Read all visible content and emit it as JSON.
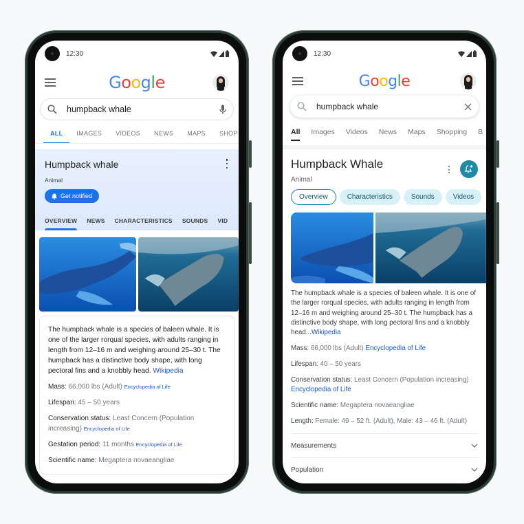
{
  "colors": {
    "page_background": "#f7f8fa",
    "google_blue": "#4285f4",
    "google_red": "#ea4335",
    "google_yellow": "#fbbc05",
    "google_green": "#34a853",
    "accent_blue": "#1a73e8",
    "teal_accent": "#1e8aa6"
  },
  "left_phone": {
    "status": {
      "time": "12:30",
      "icons": [
        "wifi-icon",
        "signal-icon",
        "battery-icon"
      ]
    },
    "header": {
      "logo": [
        "G",
        "o",
        "o",
        "g",
        "l",
        "e"
      ],
      "menu_icon": "menu-icon",
      "avatar": "avatar"
    },
    "search": {
      "value": "humpback whale",
      "left_icon": "search-icon",
      "right_icon": "mic-icon"
    },
    "tabs": [
      {
        "label": "ALL",
        "active": true
      },
      {
        "label": "IMAGES"
      },
      {
        "label": "VIDEOS"
      },
      {
        "label": "NEWS"
      },
      {
        "label": "MAPS"
      },
      {
        "label": "SHOP"
      }
    ],
    "knowledge_panel": {
      "title": "Humpback whale",
      "subtitle": "Animal",
      "notify_label": "Get notified",
      "tabs": [
        {
          "label": "OVERVIEW",
          "active": true
        },
        {
          "label": "NEWS"
        },
        {
          "label": "CHARACTERISTICS"
        },
        {
          "label": "SOUNDS"
        },
        {
          "label": "VID"
        }
      ]
    },
    "description": {
      "text": "The humpback whale is a species of baleen whale. It is one of the larger rorqual species, with adults ranging in length from 12–16 m and weighing around 25–30 t. The humpback has a distinctive body shape, with long pectoral fins and a knobbly head.",
      "source": "Wikipedia"
    },
    "facts": [
      {
        "label": "Mass:",
        "value": "66,000 lbs (Adult)",
        "source": "Encyclopedia of Life"
      },
      {
        "label": "Lifespan:",
        "value": "45 – 50 years",
        "source": ""
      },
      {
        "label": "Conservation status:",
        "value": "Least Concern (Population increasing)",
        "source": "Encyclopedia of Life"
      },
      {
        "label": "Gestation period:",
        "value": "11 months",
        "source": "Encyclopedia of Life"
      },
      {
        "label": "Scientific name:",
        "value": "Megaptera novaeangliae",
        "source": ""
      }
    ]
  },
  "right_phone": {
    "status": {
      "time": "12:30",
      "icons": [
        "wifi-icon",
        "signal-icon",
        "battery-icon"
      ]
    },
    "header": {
      "logo": [
        "G",
        "o",
        "o",
        "g",
        "l",
        "e"
      ],
      "menu_icon": "menu-icon",
      "avatar": "avatar"
    },
    "search": {
      "value": "humpback whale",
      "left_icon": "search-icon",
      "right_icon": "clear-icon"
    },
    "tabs": [
      {
        "label": "All",
        "active": true
      },
      {
        "label": "Images"
      },
      {
        "label": "Videos"
      },
      {
        "label": "News"
      },
      {
        "label": "Maps"
      },
      {
        "label": "Shopping"
      },
      {
        "label": "B"
      }
    ],
    "knowledge_panel": {
      "title": "Humpback Whale",
      "subtitle": "Animal",
      "notify_icon": "bell-plus-icon",
      "chips": [
        {
          "label": "Overview",
          "active": true
        },
        {
          "label": "Characteristics"
        },
        {
          "label": "Sounds"
        },
        {
          "label": "Videos"
        }
      ]
    },
    "description": {
      "text": "The humpback whale is a species of baleen whale. It is one of the larger rorqual species, with adults ranging in length from 12–16 m and weighing around 25–30 t. The humpback has a distinctive body shape, with long pectoral fins and a knobbly head...",
      "source": "Wikipedia"
    },
    "facts": [
      {
        "label": "Mass:",
        "value": "66,000 lbs (Adult)",
        "source": "Encyclopedia of Life"
      },
      {
        "label": "Lifespan:",
        "value": "40 – 50 years",
        "source": ""
      },
      {
        "label": "Conservation status:",
        "value": "Least Concern (Population increasing)",
        "source": "Encyclopedia of Life"
      },
      {
        "label": "Scientific name:",
        "value": "Megaptera novaeangliae",
        "source": ""
      },
      {
        "label": "Length:",
        "value": "Female: 49 – 52 ft. (Adult), Male: 43 – 46 ft. (Adult)",
        "source": ""
      }
    ],
    "accordions": [
      {
        "label": "Measurements"
      },
      {
        "label": "Population"
      }
    ]
  }
}
